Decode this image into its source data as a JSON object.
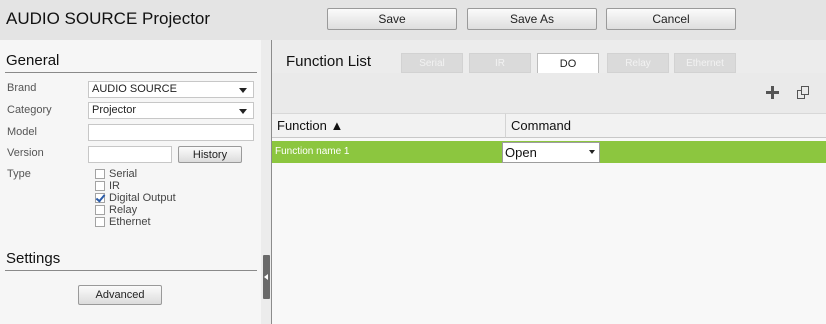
{
  "header": {
    "title": "AUDIO SOURCE Projector",
    "save_label": "Save",
    "save_as_label": "Save As",
    "cancel_label": "Cancel"
  },
  "general": {
    "title": "General",
    "brand_label": "Brand",
    "brand_value": "AUDIO SOURCE",
    "category_label": "Category",
    "category_value": "Projector",
    "model_label": "Model",
    "model_value": "",
    "version_label": "Version",
    "version_value": "",
    "history_label": "History",
    "type_label": "Type",
    "types": [
      {
        "label": "Serial",
        "checked": false
      },
      {
        "label": "IR",
        "checked": false
      },
      {
        "label": "Digital Output",
        "checked": true
      },
      {
        "label": "Relay",
        "checked": false
      },
      {
        "label": "Ethernet",
        "checked": false
      }
    ]
  },
  "settings": {
    "title": "Settings",
    "advanced_label": "Advanced"
  },
  "function_list": {
    "title": "Function List",
    "tabs": [
      {
        "label": "Serial",
        "active": false
      },
      {
        "label": "IR",
        "active": false
      },
      {
        "label": "DO",
        "active": true
      },
      {
        "label": "Relay",
        "active": false
      },
      {
        "label": "Ethernet",
        "active": false
      }
    ],
    "icons": [
      "add-icon",
      "copy-icon"
    ],
    "columns": {
      "function": "Function ▲",
      "command": "Command"
    },
    "rows": [
      {
        "function": "Function name 1",
        "command": "Open"
      }
    ]
  },
  "colors": {
    "selected_row": "#8cc63f",
    "header_bg": "#e4e4e4",
    "panel_bg": "#f6f6f6"
  }
}
